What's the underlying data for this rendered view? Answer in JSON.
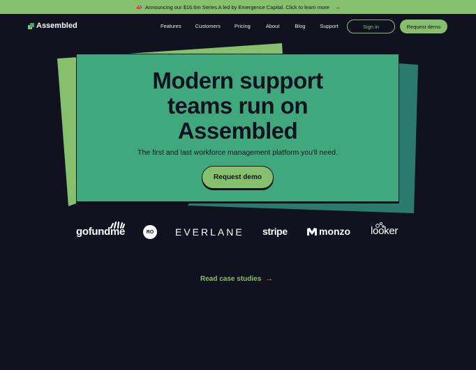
{
  "announcement": {
    "icon": "megaphone-icon",
    "text": "Announcing our $16.6m Series A led by Emergence Capital. Click to learn more",
    "arrow_icon": "arrow-right-icon"
  },
  "nav": {
    "logo_text": "Assembled",
    "links": [
      "Features",
      "Customers",
      "Pricing",
      "About",
      "Blog",
      "Support"
    ],
    "signin_label": "Sign in",
    "demo_label": "Request demo"
  },
  "hero": {
    "title_lines": [
      "Modern support",
      "teams run on",
      "Assembled"
    ],
    "subtitle": "The first and last workforce management platform you'll need.",
    "cta_label": "Request demo"
  },
  "logos": {
    "gofundme": "gofundme",
    "ro": "RO",
    "everlane": "EVERLANE",
    "stripe": "stripe",
    "monzo": "monzo",
    "looker": "looker"
  },
  "case_studies": {
    "label": "Read case studies",
    "arrow_icon": "arrow-right-icon"
  },
  "colors": {
    "background": "#11121f",
    "accent_green": "#86c06c",
    "hero_green": "#3fa97d",
    "teal_shadow": "#2a7a6d"
  }
}
